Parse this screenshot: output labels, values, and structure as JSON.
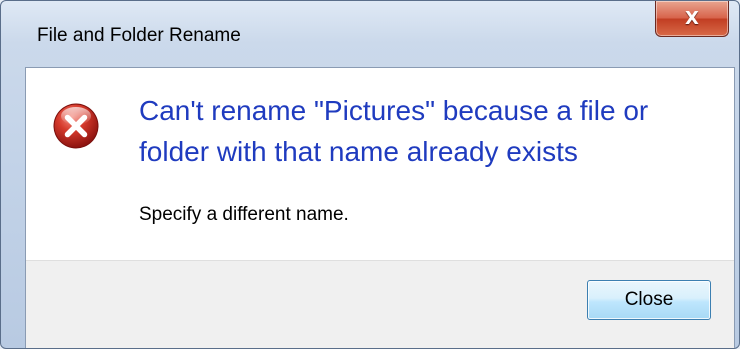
{
  "window": {
    "title": "File and Folder Rename",
    "close_glyph": "X"
  },
  "dialog": {
    "icon": "error-icon",
    "main_instruction": "Can't rename \"Pictures\" because a file or folder with that name already exists",
    "secondary_text": "Specify a different name."
  },
  "footer": {
    "close_button_label": "Close"
  },
  "colors": {
    "instruction_blue": "#1f3bbf",
    "error_red": "#c8201e",
    "titlebar_close_red": "#c23e23"
  }
}
